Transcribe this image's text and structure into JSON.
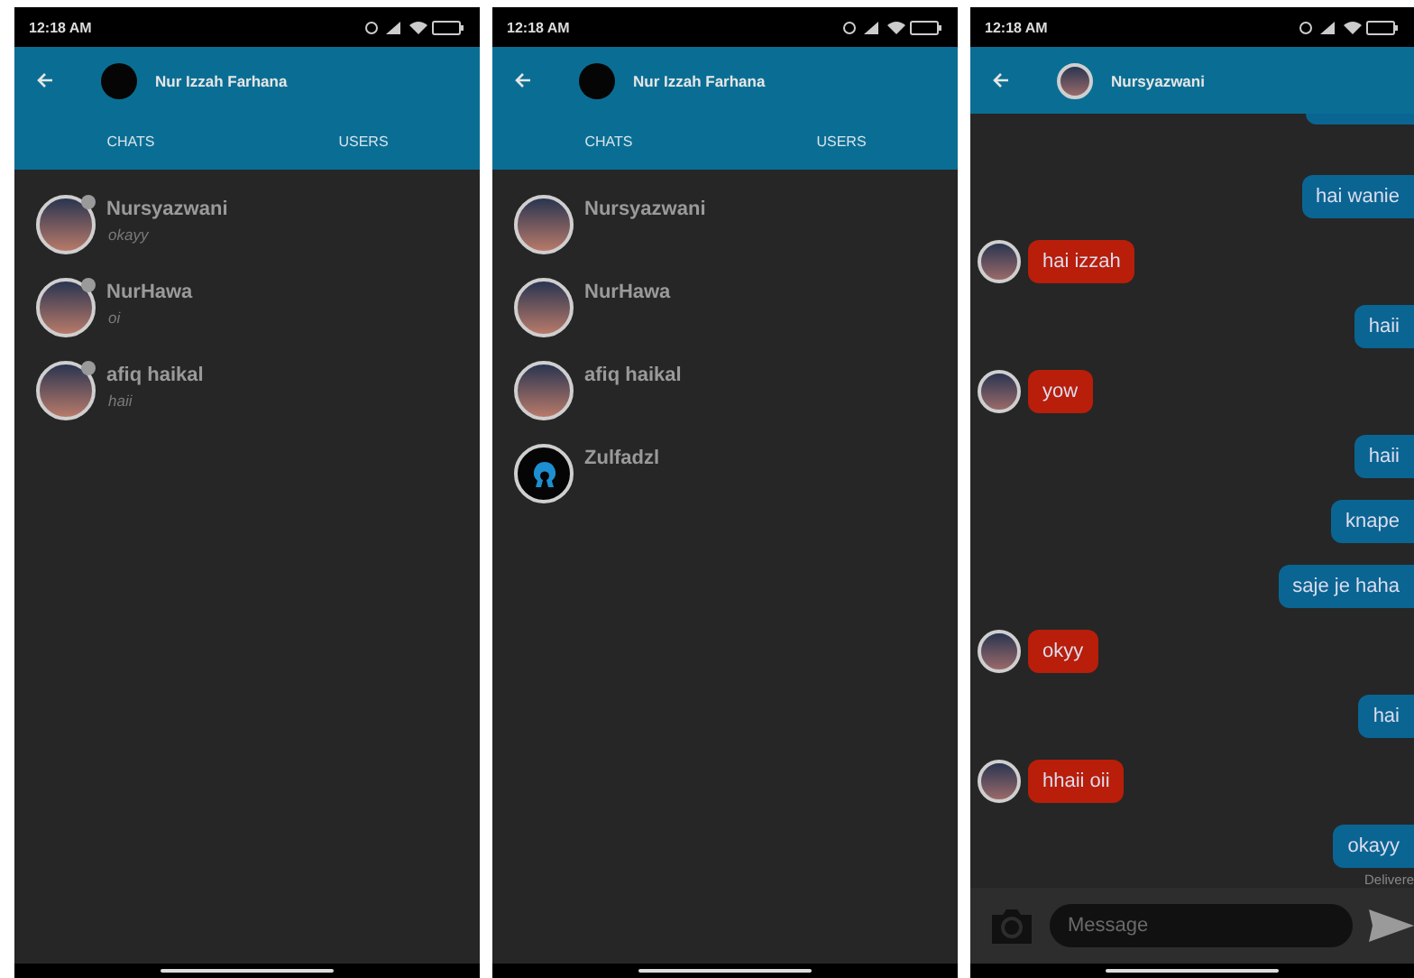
{
  "screens": [
    {
      "kind": "list",
      "status_bar": {
        "time": "12:18 AM"
      },
      "header": {
        "title": "Nur Izzah Farhana"
      },
      "tabs": [
        {
          "label": "CHATS"
        },
        {
          "label": "USERS"
        }
      ],
      "items": [
        {
          "name": "Nursyazwani",
          "last_message": "okayy",
          "kind": "photo",
          "online": false
        },
        {
          "name": "NurHawa",
          "last_message": "oi",
          "kind": "photo",
          "online": false
        },
        {
          "name": "afiq haikal",
          "last_message": "haii",
          "kind": "photo",
          "online": false
        }
      ]
    },
    {
      "kind": "list",
      "status_bar": {
        "time": "12:18 AM"
      },
      "header": {
        "title": "Nur Izzah Farhana"
      },
      "tabs": [
        {
          "label": "CHATS"
        },
        {
          "label": "USERS"
        }
      ],
      "items": [
        {
          "name": "Nursyazwani",
          "kind": "photo"
        },
        {
          "name": "NurHawa",
          "kind": "photo"
        },
        {
          "name": "afiq haikal",
          "kind": "photo"
        },
        {
          "name": "Zulfadzl",
          "kind": "default"
        }
      ]
    },
    {
      "kind": "chat",
      "status_bar": {
        "time": "12:18 AM"
      },
      "header": {
        "title": "Nursyazwani"
      },
      "messages": [
        {
          "kind": "sent",
          "text": "hai wanie"
        },
        {
          "kind": "received",
          "text": "hai izzah"
        },
        {
          "kind": "sent",
          "text": "haii"
        },
        {
          "kind": "received",
          "text": "yow"
        },
        {
          "kind": "sent",
          "text": "haii"
        },
        {
          "kind": "sent",
          "text": "knape"
        },
        {
          "kind": "sent",
          "text": "saje je haha"
        },
        {
          "kind": "received",
          "text": "okyy"
        },
        {
          "kind": "sent",
          "text": "hai"
        },
        {
          "kind": "received",
          "text": "hhaii oii"
        },
        {
          "kind": "sent",
          "text": "okayy",
          "status": "Delivere"
        }
      ],
      "composer": {
        "placeholder": "Message"
      }
    }
  ]
}
